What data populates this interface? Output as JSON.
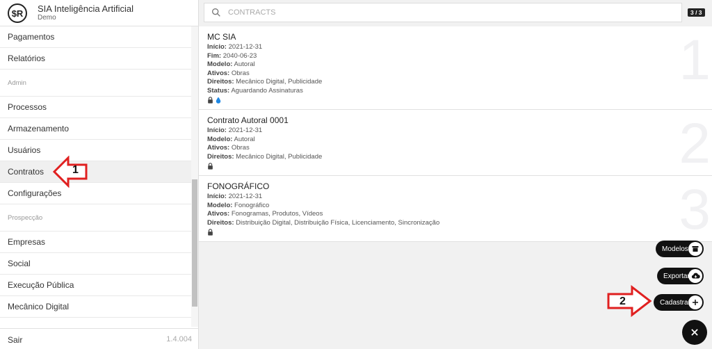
{
  "brand": {
    "logo": "$R",
    "title": "SIA Inteligência Artificial",
    "subtitle": "Demo"
  },
  "sidebar": {
    "items": [
      {
        "label": "Pagamentos",
        "type": "item"
      },
      {
        "label": "Relatórios",
        "type": "item"
      },
      {
        "label": "Admin",
        "type": "section"
      },
      {
        "label": "Processos",
        "type": "item"
      },
      {
        "label": "Armazenamento",
        "type": "item"
      },
      {
        "label": "Usuários",
        "type": "item"
      },
      {
        "label": "Contratos",
        "type": "item",
        "active": true
      },
      {
        "label": "Configurações",
        "type": "item"
      },
      {
        "label": "Prospecção",
        "type": "section"
      },
      {
        "label": "Empresas",
        "type": "item"
      },
      {
        "label": "Social",
        "type": "item"
      },
      {
        "label": "Execução Pública",
        "type": "item"
      },
      {
        "label": "Mecânico Digital",
        "type": "item"
      }
    ],
    "logout": "Sair",
    "version": "1.4.004"
  },
  "search": {
    "placeholder": "CONTRACTS",
    "counter": "3 / 3"
  },
  "contracts": [
    {
      "title": "MC SIA",
      "number": "1",
      "fields": [
        {
          "k": "Início:",
          "v": " 2021-12-31"
        },
        {
          "k": "Fim:",
          "v": " 2040-06-23"
        },
        {
          "k": "Modelo:",
          "v": " Autoral"
        },
        {
          "k": "Ativos:",
          "v": " Obras"
        },
        {
          "k": "Direitos:",
          "v": " Mecânico Digital, Publicidade"
        },
        {
          "k": "Status:",
          "v": " Aguardando Assinaturas"
        }
      ],
      "icons": [
        "lock-icon",
        "drop-icon"
      ]
    },
    {
      "title": "Contrato Autoral 0001",
      "number": "2",
      "fields": [
        {
          "k": "Início:",
          "v": " 2021-12-31"
        },
        {
          "k": "Modelo:",
          "v": " Autoral"
        },
        {
          "k": "Ativos:",
          "v": " Obras"
        },
        {
          "k": "Direitos:",
          "v": " Mecânico Digital, Publicidade"
        }
      ],
      "icons": [
        "lock-icon"
      ]
    },
    {
      "title": "FONOGRÁFICO",
      "number": "3",
      "fields": [
        {
          "k": "Início:",
          "v": " 2021-12-31"
        },
        {
          "k": "Modelo:",
          "v": " Fonográfico"
        },
        {
          "k": "Ativos:",
          "v": " Fonogramas, Produtos, Vídeos"
        },
        {
          "k": "Direitos:",
          "v": " Distribuição Digital, Distribuição Física, Licenciamento, Sincronização"
        }
      ],
      "icons": [
        "lock-icon"
      ]
    }
  ],
  "fabs": {
    "models": "Modelos",
    "export": "Exportar",
    "register": "Cadastrar"
  },
  "callouts": {
    "one": "1",
    "two": "2"
  },
  "colors": {
    "callout_red": "#e02020",
    "fab_bg": "#111111",
    "drop_blue": "#1e88e5"
  }
}
